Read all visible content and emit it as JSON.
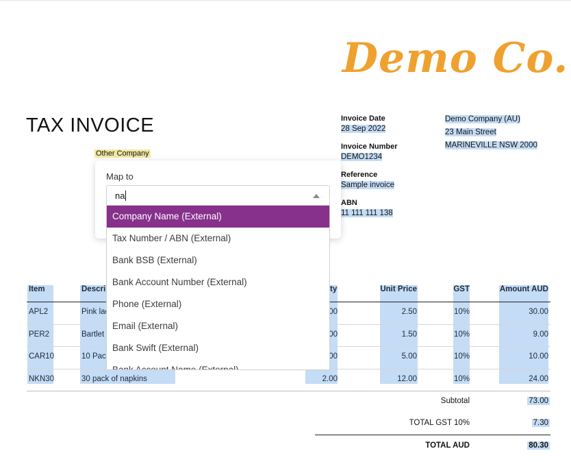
{
  "logo": {
    "text": "Demo Co."
  },
  "title": "TAX INVOICE",
  "other_company": "Other Company",
  "invoice_meta": {
    "date_label": "Invoice Date",
    "date_value": "28 Sep 2022",
    "number_label": "Invoice Number",
    "number_value": "DEMO1234",
    "reference_label": "Reference",
    "reference_value": "Sample invoice",
    "abn_label": "ABN",
    "abn_value": "11 111 111 138"
  },
  "seller": {
    "name": "Demo Company (AU)",
    "street": "23 Main Street",
    "city": "MARINEVILLE NSW 2000"
  },
  "table": {
    "headers": {
      "item": "Item",
      "description": "Descrip",
      "quantity": "ty",
      "unit_price": "Unit Price",
      "gst": "GST",
      "amount": "Amount AUD"
    },
    "rows": [
      {
        "item": "APL2",
        "description": "Pink lad",
        "quantity": "00",
        "unit_price": "2.50",
        "gst": "10%",
        "amount": "30.00"
      },
      {
        "item": "PER2",
        "description": "Bartlet",
        "quantity": "00",
        "unit_price": "1.50",
        "gst": "10%",
        "amount": "9.00"
      },
      {
        "item": "CAR10",
        "description": "10 Pack",
        "quantity": "00",
        "unit_price": "5.00",
        "gst": "10%",
        "amount": "10.00"
      },
      {
        "item": "NKN30",
        "description": "30 pack of napkins",
        "quantity": "2.00",
        "unit_price": "12.00",
        "gst": "10%",
        "amount": "24.00"
      }
    ]
  },
  "totals": {
    "subtotal_label": "Subtotal",
    "subtotal_value": "73.00",
    "gst_label": "TOTAL  GST  10%",
    "gst_value": "7.30",
    "total_label": "TOTAL AUD",
    "total_value": "80.30"
  },
  "mapping": {
    "label": "Map to",
    "input_value": "na",
    "options": [
      "Company Name (External)",
      "Tax Number / ABN (External)",
      "Bank BSB (External)",
      "Bank Account Number (External)",
      "Phone (External)",
      "Email (External)",
      "Bank Swift (External)",
      "Bank Account Name (External)"
    ],
    "selected_index": 0
  },
  "colors": {
    "logo": "#efa12f",
    "highlight": "#c4dcf5",
    "highlight_yellow": "#f2e7a2",
    "selected_option": "#87308c"
  }
}
